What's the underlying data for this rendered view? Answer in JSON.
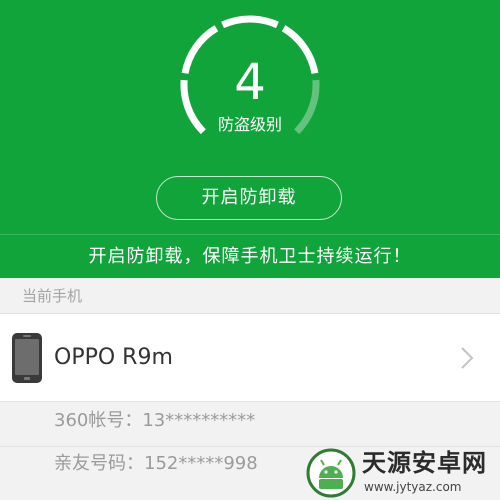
{
  "theme": {
    "accent": "#10a43a",
    "background": "#f2f2f2"
  },
  "protection": {
    "level": "4",
    "level_label": "防盗级别",
    "gauge_fill_fraction": 0.8,
    "button_label": "开启防卸载",
    "banner": "开启防卸载，保障手机卫士持续运行！"
  },
  "current_phone": {
    "section_title": "当前手机",
    "device_icon": "smartphone-icon",
    "device_name": "OPPO R9m",
    "chevron_icon": "chevron-right-icon",
    "account_line": "360帐号：13**********",
    "contact_line": "亲友号码：152*****998"
  },
  "watermark": {
    "name": "天源安卓网",
    "url": "www.jytyaz.com"
  }
}
